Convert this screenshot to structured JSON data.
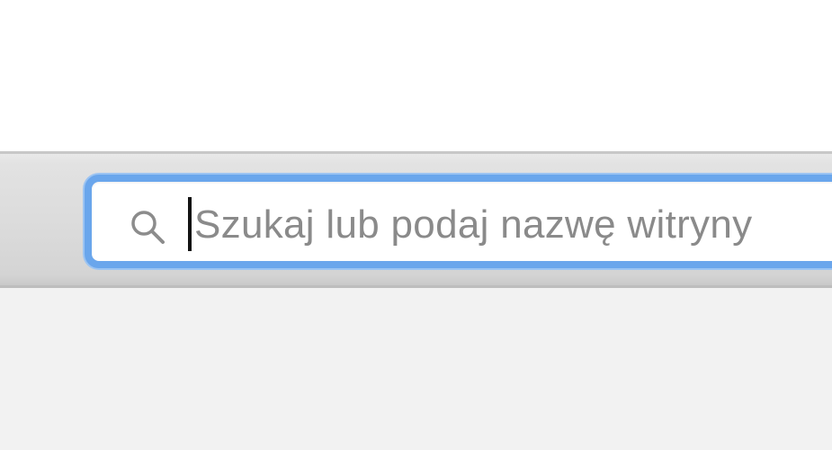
{
  "browser": {
    "address_bar": {
      "value": "",
      "placeholder": "Szukaj lub podaj nazwę witryny",
      "focused": true,
      "icon": "search-icon"
    }
  },
  "colors": {
    "focus_ring": "#6aa6ec",
    "toolbar_bg": "#dcdcdc",
    "placeholder_text": "#8a8a8a",
    "content_bg": "#f2f2f2"
  }
}
